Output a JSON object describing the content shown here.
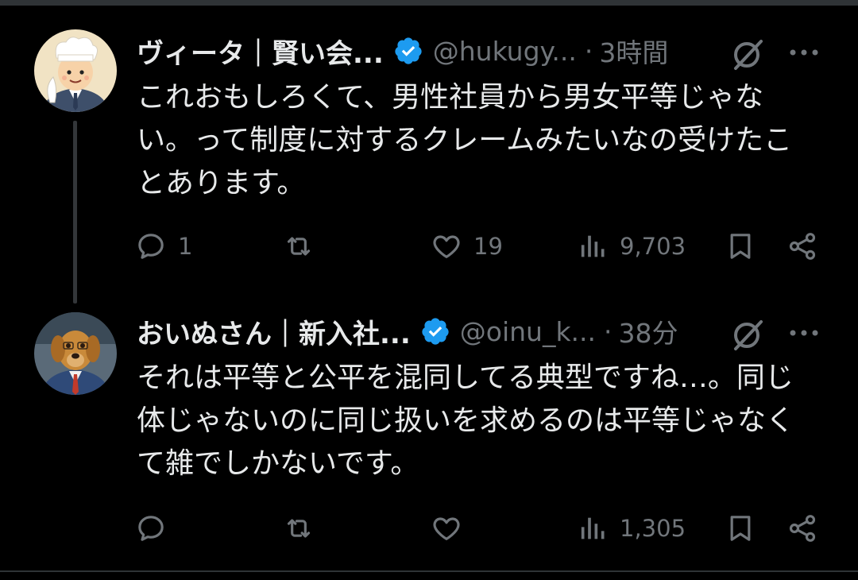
{
  "colors": {
    "background": "#000000",
    "text": "#e7e9ea",
    "muted": "#71767b",
    "verified": "#1d9bf0",
    "divider": "#2f3336"
  },
  "tweets": [
    {
      "display_name": "ヴィータ｜賢い会...",
      "handle": "@hukugy...",
      "separator": "·",
      "time": "3時間",
      "text": "これおもしろくて、男性社員から男女平等じゃない。って制度に対するクレームみたいなの受けたことあります。",
      "avatar_icon": "chef-cartoon-avatar",
      "replies": "1",
      "retweets": "",
      "likes": "19",
      "views": "9,703"
    },
    {
      "display_name": "おいぬさん｜新入社...",
      "handle": "@oinu_k...",
      "separator": "·",
      "time": "38分",
      "text": "それは平等と公平を混同してる典型ですね…。同じ体じゃないのに同じ扱いを求めるのは平等じゃなくて雑でしかないです。",
      "avatar_icon": "dog-in-suit-avatar",
      "replies": "",
      "retweets": "",
      "likes": "",
      "views": "1,305"
    }
  ]
}
